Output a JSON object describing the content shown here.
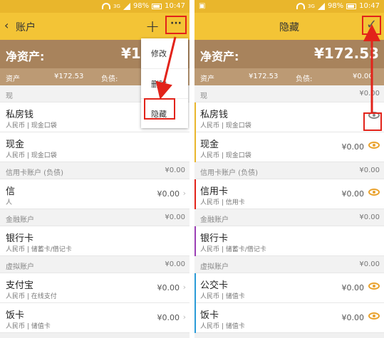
{
  "status": {
    "signal": "3G",
    "battery": "98%",
    "time": "10:47"
  },
  "left": {
    "title": "账户",
    "net_asset_label": "净资产:",
    "net_asset_value": "¥1",
    "sub": {
      "asset_label": "资产",
      "asset_value": "¥172.53",
      "liability_label": "负债:"
    },
    "menu": [
      "修改",
      "删除",
      "隐藏"
    ],
    "rows": [
      {
        "kind": "header",
        "name": "现",
        "amount": ""
      },
      {
        "kind": "item",
        "name": "私房钱",
        "sub": "人民币 | 现金口袋",
        "amount": ""
      },
      {
        "kind": "item",
        "name": "现金",
        "sub": "人民币 | 现金口袋",
        "amount": ""
      },
      {
        "kind": "header",
        "name": "信用卡账户 (负债)",
        "amount": "¥0.00"
      },
      {
        "kind": "item",
        "name": "信",
        "sub": "人",
        "amount": "¥0.00"
      },
      {
        "kind": "header",
        "name": "金融账户",
        "amount": "¥0.00"
      },
      {
        "kind": "item",
        "name": "银行卡",
        "sub": "人民币 | 储蓄卡/借记卡",
        "amount": ""
      },
      {
        "kind": "header",
        "name": "虚拟账户",
        "amount": "¥0.00"
      },
      {
        "kind": "item",
        "name": "支付宝",
        "sub": "人民币 | 在线支付",
        "amount": "¥0.00"
      },
      {
        "kind": "item",
        "name": "饭卡",
        "sub": "人民币 | 储值卡",
        "amount": "¥0.00"
      }
    ]
  },
  "right": {
    "title": "隐藏",
    "net_asset_label": "净资产:",
    "net_asset_value": "¥172.53",
    "sub": {
      "asset_label": "资产",
      "asset_value": "¥172.53",
      "liability_label": "负债:",
      "liability_value": "¥0.00"
    },
    "rows": [
      {
        "kind": "header",
        "name": "现",
        "amount": "¥0.00"
      },
      {
        "kind": "item",
        "name": "私房钱",
        "sub": "人民币 | 现金口袋",
        "amount": "",
        "eye": "off"
      },
      {
        "kind": "item",
        "name": "现金",
        "sub": "人民币 | 现金口袋",
        "amount": "¥0.00",
        "eye": "on"
      },
      {
        "kind": "header",
        "name": "信用卡账户 (负债)",
        "amount": "¥0.00"
      },
      {
        "kind": "item",
        "name": "信用卡",
        "sub": "人民币 | 信用卡",
        "amount": "¥0.00",
        "eye": "on"
      },
      {
        "kind": "header",
        "name": "金融账户",
        "amount": "¥0.00"
      },
      {
        "kind": "item",
        "name": "银行卡",
        "sub": "人民币 | 储蓄卡/借记卡",
        "amount": "",
        "eye": ""
      },
      {
        "kind": "header",
        "name": "虚拟账户",
        "amount": "¥0.00"
      },
      {
        "kind": "item",
        "name": "公交卡",
        "sub": "人民币 | 储值卡",
        "amount": "¥0.00",
        "eye": "on"
      },
      {
        "kind": "item",
        "name": "饭卡",
        "sub": "人民币 | 储值卡",
        "amount": "¥0.00",
        "eye": "on"
      }
    ]
  },
  "colors": {
    "top_bar": "#f3c436",
    "asset_bar": "#a8835c",
    "sub_bar": "#bc9a74",
    "highlight": "#e2231a",
    "eye": "#e9a12b"
  }
}
